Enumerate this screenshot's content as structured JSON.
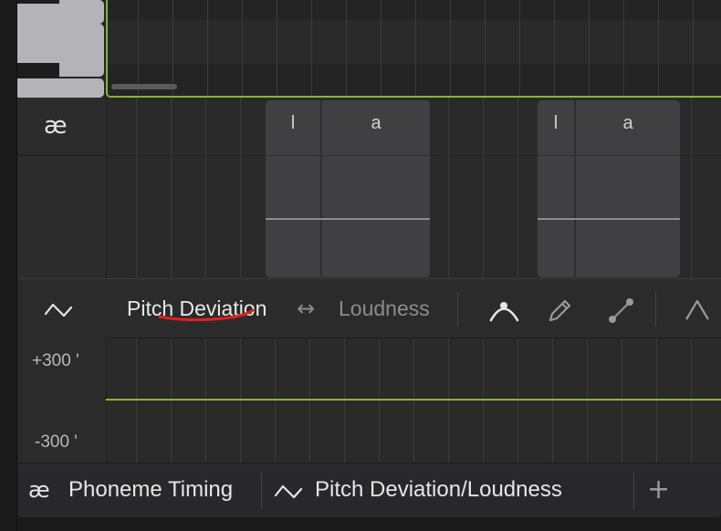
{
  "phoneme_panel": {
    "header_icon": "æ",
    "notes": [
      {
        "phonemes": [
          "l",
          "a"
        ]
      },
      {
        "phonemes": [
          "l",
          "a"
        ]
      }
    ]
  },
  "param_panel": {
    "header_icon": "pitch-curve-icon",
    "primary_param": "Pitch Deviation",
    "swap_icon": "↔",
    "secondary_param": "Loudness",
    "tools": [
      "vibrato-curve-icon",
      "pencil-icon",
      "line-tool-icon",
      "anchor-icon"
    ],
    "range_max": "+300 '",
    "range_min": "-300 '"
  },
  "bottom_tabs": {
    "phoneme_icon": "æ",
    "phoneme_label": "Phoneme Timing",
    "param_icon": "pitch-curve-icon",
    "param_label": "Pitch Deviation/Loudness",
    "add_label": "+"
  },
  "colors": {
    "accent_green": "#86b53c",
    "annotation_red": "#e02020",
    "panel_bg": "#2a2a2b",
    "phoneme_block": "#404042"
  }
}
